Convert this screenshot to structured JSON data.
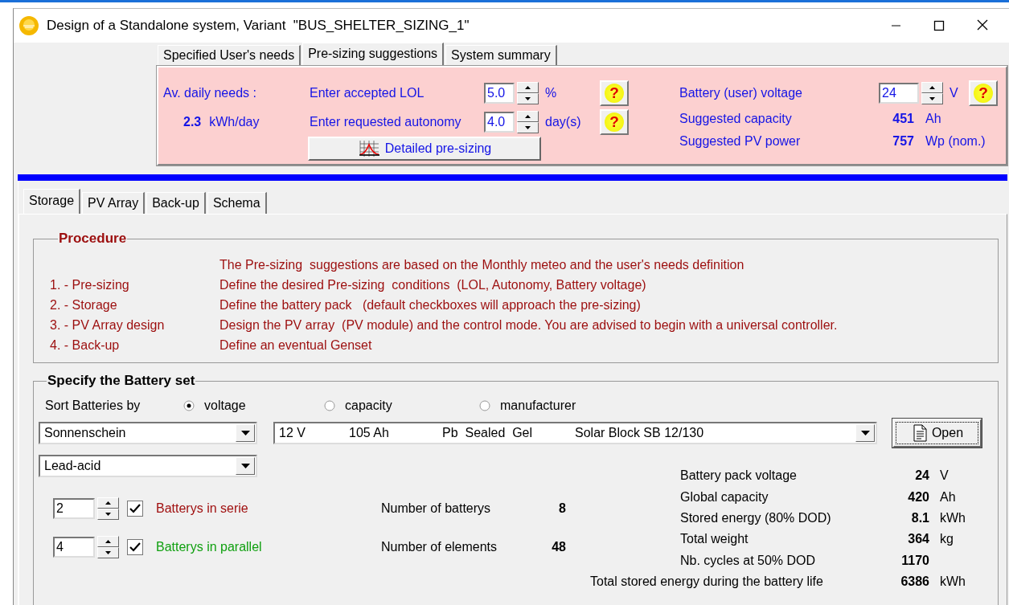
{
  "window": {
    "title": "Design of a Standalone system, Variant  \"BUS_SHELTER_SIZING_1\""
  },
  "top_tabs": [
    {
      "label": "Specified User's needs",
      "selected": false
    },
    {
      "label": "Pre-sizing suggestions",
      "selected": true
    },
    {
      "label": "System summary",
      "selected": false
    }
  ],
  "presizing": {
    "needs_label": "Av. daily needs :",
    "needs_value": "2.3",
    "needs_unit": "kWh/day",
    "inputs": [
      {
        "label": "Enter accepted LOL",
        "value": "5.0",
        "unit": "%",
        "help": "?"
      },
      {
        "label": "Enter requested autonomy",
        "value": "4.0",
        "unit": "day(s)",
        "help": "?"
      }
    ],
    "detail_button": "Detailed pre-sizing",
    "voltage": {
      "label": "Battery (user) voltage",
      "value": "24",
      "unit": "V",
      "help": "?"
    },
    "suggestions": [
      {
        "label": "Suggested capacity",
        "value": "451",
        "unit": "Ah"
      },
      {
        "label": "Suggested PV power",
        "value": "757",
        "unit": "Wp (nom.)"
      }
    ]
  },
  "lower_tabs": [
    {
      "label": "Storage",
      "selected": true
    },
    {
      "label": "PV Array",
      "selected": false
    },
    {
      "label": "Back-up",
      "selected": false
    },
    {
      "label": "Schema",
      "selected": false
    }
  ],
  "procedure": {
    "title": "Procedure",
    "intro": "The Pre-sizing  suggestions are based on the Monthly meteo and the user's needs definition",
    "steps": [
      {
        "step": "1. - Pre-sizing",
        "text": "Define the desired Pre-sizing  conditions  (LOL, Autonomy, Battery voltage)"
      },
      {
        "step": "2. - Storage",
        "text": "Define the battery pack   (default checkboxes will approach the pre-sizing)"
      },
      {
        "step": "3. - PV Array design",
        "text": "Design the PV array  (PV module) and the control mode. You are advised to begin with a universal controller."
      },
      {
        "step": "4. - Back-up",
        "text": "Define an eventual Genset"
      }
    ]
  },
  "battery_set": {
    "title": "Specify the Battery set",
    "sort_label": "Sort Batteries by",
    "sort_options": [
      {
        "label": "voltage",
        "selected": true
      },
      {
        "label": "capacity",
        "selected": false
      },
      {
        "label": "manufacturer",
        "selected": false
      }
    ],
    "manufacturer": "Sonnenschein",
    "battery": {
      "voltage": "12 V",
      "capacity": "105 Ah",
      "technology": "Pb  Sealed  Gel",
      "model": "Solar Block SB 12/130"
    },
    "open_button": "Open",
    "type": "Lead-acid",
    "arrangement": [
      {
        "value": "2",
        "checked": true,
        "label": "Batterys in serie",
        "color": "#a01010",
        "count_label": "Number of batterys",
        "count": "8"
      },
      {
        "value": "4",
        "checked": true,
        "label": "Batterys in parallel",
        "color": "#10a010",
        "count_label": "Number of elements",
        "count": "48"
      }
    ],
    "results": [
      {
        "kind": "row",
        "label": "Battery pack voltage",
        "value": "24",
        "unit": "V"
      },
      {
        "kind": "row",
        "label": "Global capacity",
        "value": "420",
        "unit": "Ah"
      },
      {
        "kind": "row",
        "label": "Stored energy (80% DOD)",
        "value": "8.1",
        "unit": "kWh"
      },
      {
        "kind": "row",
        "label": "Total weight",
        "value": "364",
        "unit": "kg"
      },
      {
        "kind": "row",
        "label": "Nb. cycles at 50% DOD",
        "value": "1170"
      },
      {
        "kind": "total",
        "label": "Total stored energy during the battery life",
        "value": "6386",
        "unit": "kWh"
      }
    ]
  }
}
